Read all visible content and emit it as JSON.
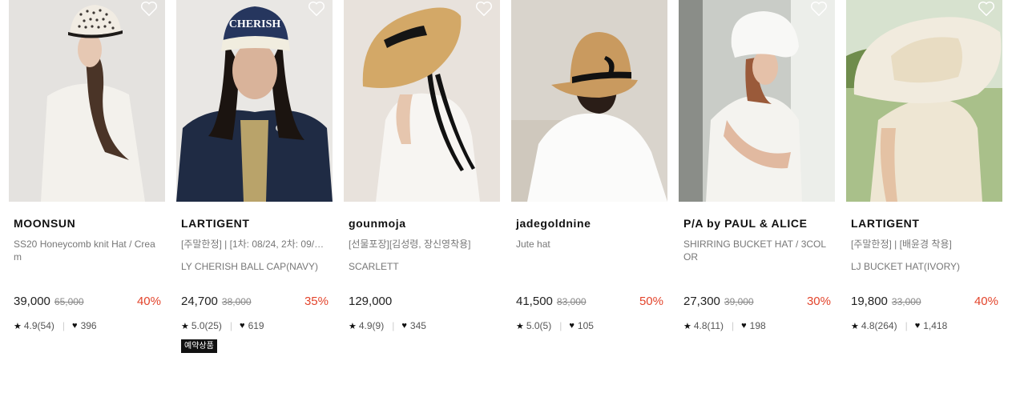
{
  "products": [
    {
      "brand": "MOONSUN",
      "desc1": "SS20 Honeycomb knit Hat / Cream",
      "desc2": "",
      "price": "39,000",
      "original_price": "65,000",
      "discount": "40%",
      "rating": "4.9(54)",
      "likes": "396",
      "badge": "",
      "image": "model-wearing-cream-knit-bucket-hat"
    },
    {
      "brand": "LARTIGENT",
      "desc1": "[주말한정] | [1차: 08/24, 2차: 09/…",
      "desc2": "LY CHERISH BALL CAP(NAVY)",
      "price": "24,700",
      "original_price": "38,000",
      "discount": "35%",
      "rating": "5.0(25)",
      "likes": "619",
      "badge": "예약상품",
      "image": "model-wearing-navy-cherish-cap"
    },
    {
      "brand": "gounmoja",
      "desc1": "[선물포장][김성령, 장신영착용]",
      "desc2": "SCARLETT",
      "price": "129,000",
      "original_price": "",
      "discount": "",
      "rating": "4.9(9)",
      "likes": "345",
      "badge": "",
      "image": "model-wearing-wide-straw-hat"
    },
    {
      "brand": "jadegoldnine",
      "desc1": "Jute hat",
      "desc2": "",
      "price": "41,500",
      "original_price": "83,000",
      "discount": "50%",
      "rating": "5.0(5)",
      "likes": "105",
      "badge": "",
      "image": "model-wearing-jute-hat-with-ribbon"
    },
    {
      "brand": "P/A by PAUL & ALICE",
      "desc1": "SHIRRING BUCKET HAT / 3COLOR",
      "desc2": "",
      "price": "27,300",
      "original_price": "39,000",
      "discount": "30%",
      "rating": "4.8(11)",
      "likes": "198",
      "badge": "",
      "image": "model-wearing-white-shirring-bucket-hat"
    },
    {
      "brand": "LARTIGENT",
      "desc1": "[주말한정] | [배윤경 착용]",
      "desc2": "LJ BUCKET HAT(IVORY)",
      "price": "19,800",
      "original_price": "33,000",
      "discount": "40%",
      "rating": "4.8(264)",
      "likes": "1,418",
      "badge": "",
      "image": "model-wearing-ivory-bucket-hat-outdoors"
    }
  ],
  "icons": {
    "wishlist": "heart-outline-icon",
    "rating": "star-icon",
    "likes": "heart-filled-icon"
  },
  "colors": {
    "discount": "#e3442b",
    "badge_bg": "#111111"
  }
}
